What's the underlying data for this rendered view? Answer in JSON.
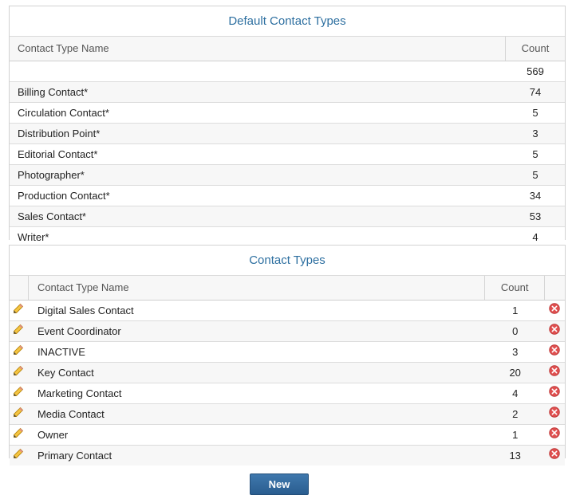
{
  "default_types": {
    "title": "Default Contact Types",
    "col_name": "Contact Type Name",
    "col_count": "Count",
    "rows": [
      {
        "name": "",
        "count": "569"
      },
      {
        "name": "Billing Contact*",
        "count": "74"
      },
      {
        "name": "Circulation Contact*",
        "count": "5"
      },
      {
        "name": "Distribution Point*",
        "count": "3"
      },
      {
        "name": "Editorial Contact*",
        "count": "5"
      },
      {
        "name": "Photographer*",
        "count": "5"
      },
      {
        "name": "Production Contact*",
        "count": "34"
      },
      {
        "name": "Sales Contact*",
        "count": "53"
      },
      {
        "name": "Writer*",
        "count": "4"
      }
    ]
  },
  "contact_types": {
    "title": "Contact Types",
    "col_name": "Contact Type Name",
    "col_count": "Count",
    "rows": [
      {
        "name": "Digital Sales Contact",
        "count": "1"
      },
      {
        "name": "Event Coordinator",
        "count": "0"
      },
      {
        "name": "INACTIVE",
        "count": "3"
      },
      {
        "name": "Key Contact",
        "count": "20"
      },
      {
        "name": "Marketing Contact",
        "count": "4"
      },
      {
        "name": "Media Contact",
        "count": "2"
      },
      {
        "name": "Owner",
        "count": "1"
      },
      {
        "name": "Primary Contact",
        "count": "13"
      }
    ]
  },
  "actions": {
    "new_label": "New"
  },
  "icons": {
    "edit": "pencil-icon",
    "delete": "delete-icon"
  },
  "colors": {
    "title": "#2d6fa0",
    "button": "#2a5d8f",
    "delete": "#e05050"
  }
}
